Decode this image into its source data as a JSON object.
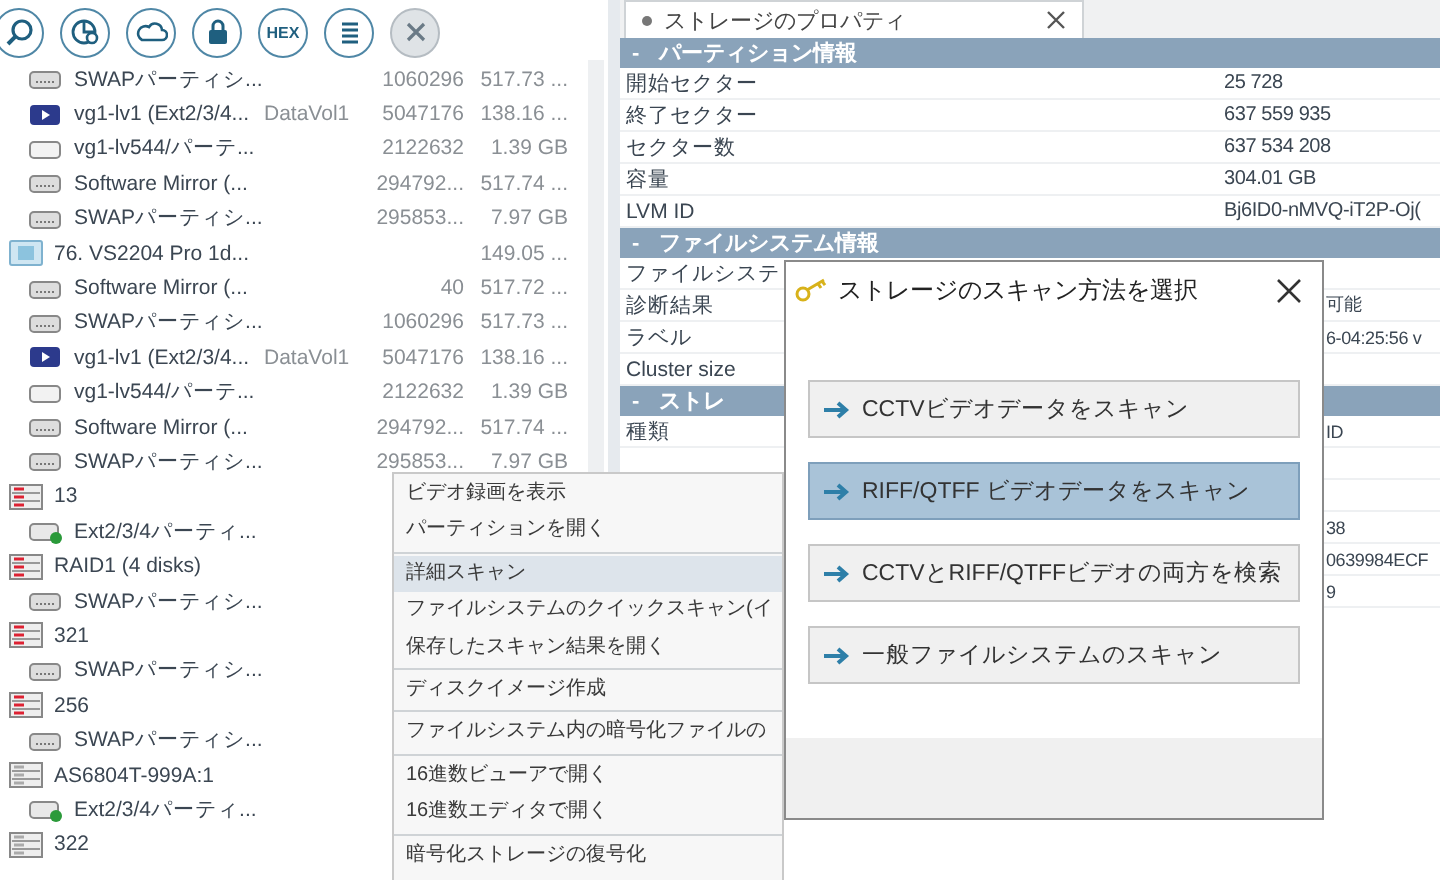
{
  "toolbar": [
    {
      "kind": "search",
      "disabled": false
    },
    {
      "kind": "chart",
      "disabled": false
    },
    {
      "kind": "cloud",
      "disabled": false
    },
    {
      "kind": "lock",
      "disabled": false
    },
    {
      "kind": "hex",
      "label": "HEX",
      "disabled": false
    },
    {
      "kind": "list",
      "disabled": false
    },
    {
      "kind": "close",
      "disabled": true
    }
  ],
  "tree": [
    {
      "children": [
        {
          "label": "SWAPパーティシ...",
          "kind": "swap",
          "count": "1060296",
          "size": "517.73 ..."
        },
        {
          "label": "vg1-lv1 (Ext2/3/4...",
          "kind": "video",
          "info": "DataVol1",
          "count": "5047176",
          "size": "138.16 ..."
        },
        {
          "label": "vg1-lv544/パーテ...",
          "kind": "partition",
          "count": "2122632",
          "size": "1.39 GB"
        },
        {
          "label": "Software Mirror (...",
          "kind": "swap",
          "count": "294792...",
          "size": "517.74 ..."
        },
        {
          "label": "SWAPパーティシ...",
          "kind": "swap",
          "count": "295853...",
          "size": "7.97 GB"
        }
      ]
    },
    {
      "label": "76. VS2204 Pro 1d...",
      "kind": "disk",
      "size": "149.05 ...",
      "children": [
        {
          "label": "Software Mirror (...",
          "kind": "swap",
          "count": "40",
          "size": "517.72 ..."
        },
        {
          "label": "SWAPパーティシ...",
          "kind": "swap",
          "count": "1060296",
          "size": "517.73 ..."
        },
        {
          "label": "vg1-lv1 (Ext2/3/4...",
          "kind": "video",
          "info": "DataVol1",
          "count": "5047176",
          "size": "138.16 ..."
        },
        {
          "label": "vg1-lv544/パーテ...",
          "kind": "partition",
          "count": "2122632",
          "size": "1.39 GB"
        },
        {
          "label": "Software Mirror (...",
          "kind": "swap",
          "count": "294792...",
          "size": "517.74 ..."
        },
        {
          "label": "SWAPパーティシ...",
          "kind": "swap",
          "count": "295853...",
          "size": "7.97 GB"
        }
      ]
    },
    {
      "label": "13",
      "kind": "raid",
      "children": [
        {
          "label": "Ext2/3/4パーティ...",
          "kind": "ext"
        }
      ]
    },
    {
      "label": "RAID1 (4 disks)",
      "kind": "raid",
      "children": [
        {
          "label": "SWAPパーティシ...",
          "kind": "swap"
        }
      ]
    },
    {
      "label": "321",
      "kind": "raid",
      "children": [
        {
          "label": "SWAPパーティシ...",
          "kind": "swap"
        }
      ]
    },
    {
      "label": "256",
      "kind": "raid",
      "children": [
        {
          "label": "SWAPパーティシ...",
          "kind": "swap"
        }
      ]
    },
    {
      "label": "AS6804T-999A:1",
      "kind": "nas",
      "children": [
        {
          "label": "Ext2/3/4パーティ...",
          "kind": "ext"
        }
      ]
    },
    {
      "label": "322",
      "kind": "nas"
    }
  ],
  "properties": {
    "tab": {
      "title": "ストレージのプロパティ"
    },
    "sections": [
      {
        "sign": "-",
        "title": "パーティション情報",
        "rows": [
          {
            "label": "開始セクター",
            "value": "25 728"
          },
          {
            "label": "終了セクター",
            "value": "637 559 935"
          },
          {
            "label": "セクター数",
            "value": "637 534 208"
          },
          {
            "label": "容量",
            "value": "304.01 GB"
          },
          {
            "label": "LVM ID",
            "value": "Bj6ID0-nMVQ-iT2P-Oj("
          }
        ]
      },
      {
        "sign": "-",
        "title": "ファイルシステム情報",
        "rows": [
          {
            "label": "ファイルシステ"
          },
          {
            "label": "診断結果",
            "value": "可能"
          },
          {
            "label": "ラベル",
            "value": "6-04:25:56 v"
          },
          {
            "label": "Cluster size"
          }
        ]
      },
      {
        "sign": "-",
        "title": "ストレ",
        "rows": [
          {
            "label": "種類",
            "value": "ID"
          },
          {},
          {},
          {
            "value": "38"
          },
          {
            "value": "0639984ECF"
          },
          {
            "value": "9"
          }
        ]
      }
    ]
  },
  "context_menu": [
    {
      "kind": "item",
      "label": "ビデオ録画を表示",
      "selected": false
    },
    {
      "kind": "item",
      "label": "パーティションを開く",
      "selected": false
    },
    {
      "kind": "separator"
    },
    {
      "kind": "item",
      "label": "詳細スキャン",
      "selected": true
    },
    {
      "kind": "item",
      "label": "ファイルシステムのクイックスキャン(イ",
      "selected": false
    },
    {
      "kind": "item",
      "label": "保存したスキャン結果を開く",
      "selected": false
    },
    {
      "kind": "separator"
    },
    {
      "kind": "item",
      "label": "ディスクイメージ作成",
      "selected": false
    },
    {
      "kind": "separator"
    },
    {
      "kind": "item",
      "label": "ファイルシステム内の暗号化ファイルの",
      "selected": false
    },
    {
      "kind": "separator"
    },
    {
      "kind": "item",
      "label": "16進数ビューアで開く",
      "selected": false
    },
    {
      "kind": "item",
      "label": "16進数エディタで開く",
      "selected": false
    },
    {
      "kind": "separator"
    },
    {
      "kind": "item",
      "label": "暗号化ストレージの復号化",
      "selected": false
    }
  ],
  "dialog": {
    "title": "ストレージのスキャン方法を選択",
    "options": [
      {
        "label": "CCTVビデオデータをスキャン",
        "selected": false
      },
      {
        "label": "RIFF/QTFF ビデオデータをスキャン",
        "selected": true
      },
      {
        "label": "CCTVとRIFF/QTFFビデオの両方を検索",
        "selected": false
      },
      {
        "label": "一般ファイルシステムのスキャン",
        "selected": false
      }
    ]
  }
}
